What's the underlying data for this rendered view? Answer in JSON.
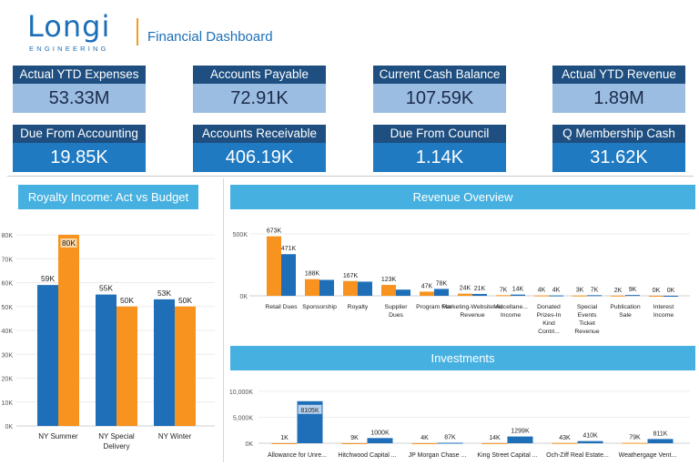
{
  "header": {
    "logo_text": "Longi",
    "logo_sub": "ENGINEERING",
    "title": "Financial Dashboard"
  },
  "kpis": [
    {
      "label": "Actual YTD Expenses",
      "value": "53.33M",
      "style": "light"
    },
    {
      "label": "Accounts Payable",
      "value": "72.91K",
      "style": "light"
    },
    {
      "label": "Current Cash Balance",
      "value": "107.59K",
      "style": "light"
    },
    {
      "label": "Actual YTD Revenue",
      "value": "1.89M",
      "style": "light"
    },
    {
      "label": "Due From Accounting",
      "value": "19.85K",
      "style": "dark"
    },
    {
      "label": "Accounts Receivable",
      "value": "406.19K",
      "style": "dark"
    },
    {
      "label": "Due From Council",
      "value": "1.14K",
      "style": "dark"
    },
    {
      "label": "Q Membership Cash",
      "value": "31.62K",
      "style": "dark"
    }
  ],
  "colors": {
    "actual": "#1f6fb8",
    "budget": "#f7931e",
    "panel_header": "#46b1e1",
    "kpi_label_bg": "#1e4f80"
  },
  "chart_data": [
    {
      "type": "bar",
      "title": "Royalty Income: Act vs Budget",
      "categories": [
        "NY Summer",
        "NY Special Delivery",
        "NY Winter"
      ],
      "series": [
        {
          "values": [
            59,
            55,
            53
          ],
          "labels": [
            "59K",
            "55K",
            "53K"
          ],
          "color": "#1f6fb8"
        },
        {
          "values": [
            80,
            50,
            50
          ],
          "labels": [
            "80K",
            "50K",
            "50K"
          ],
          "color": "#f7931e"
        }
      ],
      "ylim": [
        0,
        80
      ],
      "yticks": [
        "0K",
        "10K",
        "20K",
        "30K",
        "40K",
        "50K",
        "60K",
        "70K",
        "80K"
      ],
      "grid": true
    },
    {
      "type": "bar",
      "title": "Revenue Overview",
      "categories": [
        "Retail Dues",
        "Sponsorship",
        "Royalty",
        "Supplier Dues",
        "Program Fee",
        "Marketing-Website-Ad Revenue",
        "Miscellaneous Income",
        "Donated Prizes-In Kind Contri...",
        "Special Events Ticket Revenue",
        "Publication Sale",
        "Interest Income"
      ],
      "category_display": [
        "Retail Dues",
        "Sponsorship",
        "Royalty",
        "Supplier Dues",
        "Program Fee",
        "Marketing-Website-Ad Revenue",
        "Miscellane... Income",
        "Donated Prizes-In Kind Contri...",
        "Special Events Ticket Revenue",
        "Publication Sale",
        "Interest Income"
      ],
      "series": [
        {
          "values": [
            673,
            188,
            167,
            123,
            47,
            24,
            7,
            4,
            3,
            2,
            0
          ],
          "labels": [
            "673K",
            "188K",
            "167K",
            "123K",
            "47K",
            "24K",
            "7K",
            "4K",
            "3K",
            "2K",
            "0K"
          ],
          "color": "#f7931e"
        },
        {
          "values": [
            471,
            180,
            160,
            70,
            78,
            21,
            14,
            4,
            7,
            9,
            0
          ],
          "labels": [
            "471K",
            "",
            "",
            "",
            "78K",
            "21K",
            "14K",
            "4K",
            "7K",
            "9K",
            "0K"
          ],
          "color": "#1f6fb8"
        }
      ],
      "ylim": [
        0,
        700
      ],
      "yticks": [
        "0K",
        "500K"
      ],
      "grid": true
    },
    {
      "type": "bar",
      "title": "Investments",
      "categories": [
        "Allowance for Unre...",
        "Hitchwood Capital ...",
        "JP Morgan Chase ...",
        "King Street Capital ...",
        "Och-Ziff Real Estate...",
        "Weathergage Vent..."
      ],
      "series": [
        {
          "values": [
            1,
            9,
            4,
            14,
            43,
            79
          ],
          "labels": [
            "1K",
            "9K",
            "4K",
            "14K",
            "43K",
            "79K"
          ],
          "color": "#f7931e"
        },
        {
          "values": [
            8105,
            1000,
            87,
            1299,
            410,
            811
          ],
          "labels": [
            "8105K",
            "1000K",
            "87K",
            "1299K",
            "410K",
            "811K"
          ],
          "color": "#1f6fb8"
        }
      ],
      "ylim": [
        0,
        10000
      ],
      "yticks": [
        "0K",
        "5,000K",
        "10,000K"
      ],
      "grid": true
    }
  ]
}
